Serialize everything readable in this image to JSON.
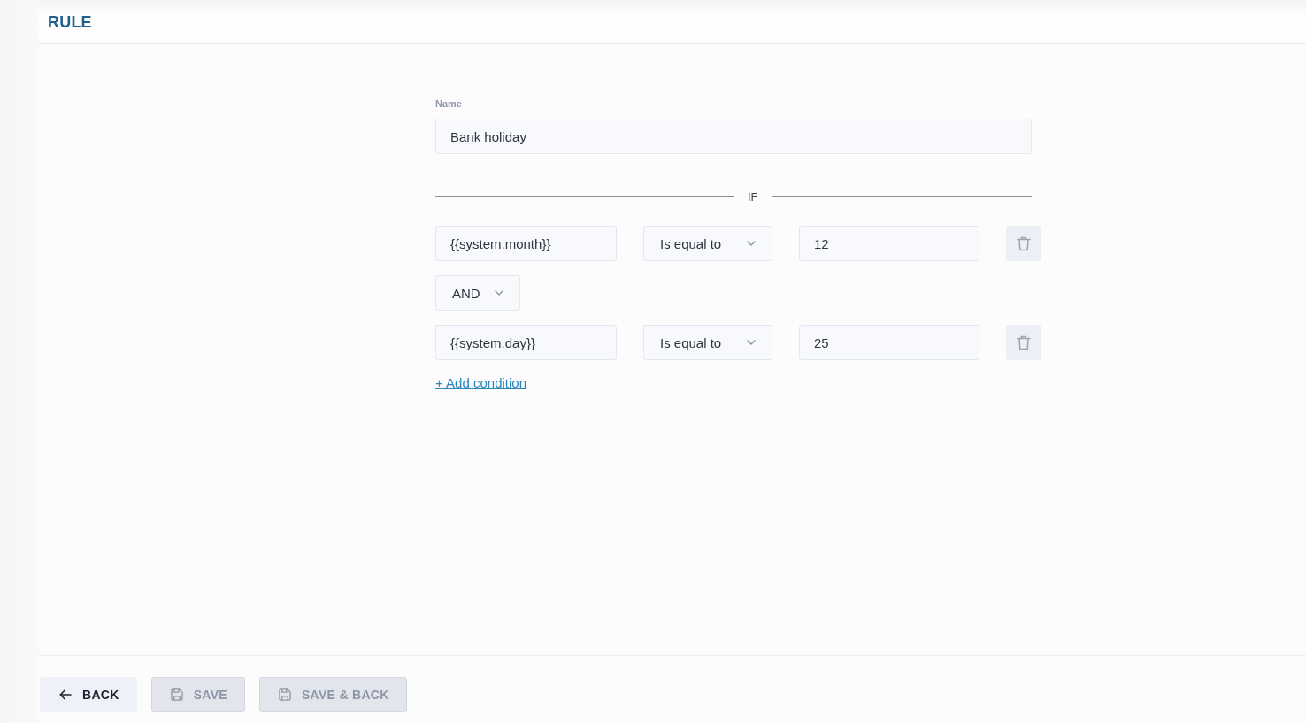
{
  "header": {
    "title": "RULE"
  },
  "form": {
    "name_field": {
      "label": "Name",
      "value": "Bank holiday"
    },
    "section_label": "IF",
    "conditions": [
      {
        "kind": "condition",
        "variable": "{{system.month}}",
        "operator": "Is equal to",
        "value": "12"
      },
      {
        "kind": "connector",
        "operator": "AND"
      },
      {
        "kind": "condition",
        "variable": "{{system.day}}",
        "operator": "Is equal to",
        "value": "25"
      }
    ],
    "add_condition_link": "+ Add condition"
  },
  "footer": {
    "buttons": [
      {
        "kind": "back",
        "label": "BACK",
        "disabled": false
      },
      {
        "kind": "save",
        "label": "SAVE",
        "disabled": true
      },
      {
        "kind": "save",
        "label": "SAVE & BACK",
        "disabled": true
      }
    ]
  }
}
